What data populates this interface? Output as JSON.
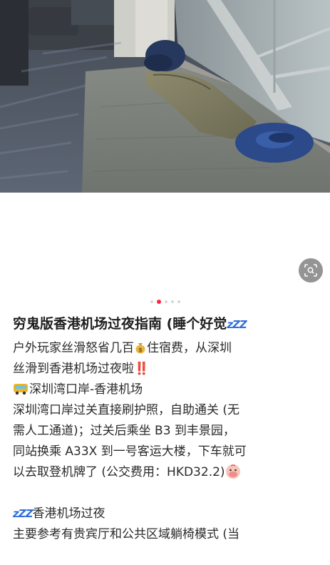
{
  "post": {
    "pagination": {
      "total": 5,
      "active_index": 1
    },
    "title": "穷鬼版香港机场过夜指南 (睡个好觉",
    "title_zzz": "zZZ",
    "lines": {
      "l1a": "户外玩家丝滑怒省几百",
      "l1b": "住宿费，从深圳",
      "l2a": "丝滑到香港机场过夜啦",
      "l2b": "‼️",
      "l3": "深圳湾口岸-香港机场",
      "l4": "深圳湾口岸过关直接刷护照，自助通关 (无",
      "l5": "需人工通道)；过关后乘坐 B3 到丰景园，",
      "l6": "同站换乘 A33X 到一号客运大楼，下车就可",
      "l7": "以去取登机牌了 (公交费用：HKD32.2)",
      "l9": "香港机场过夜",
      "l9_zzz": "zZZ",
      "l10": "主要参考有贵宾厅和公共区域躺椅模式 (当"
    }
  },
  "icons": {
    "scan": "scan-search-icon",
    "money": "money-bag-icon",
    "bus": "bus-icon",
    "face": "sick-face-icon"
  },
  "colors": {
    "accent": "#ff2442",
    "zzz": "#2f6fdc"
  }
}
